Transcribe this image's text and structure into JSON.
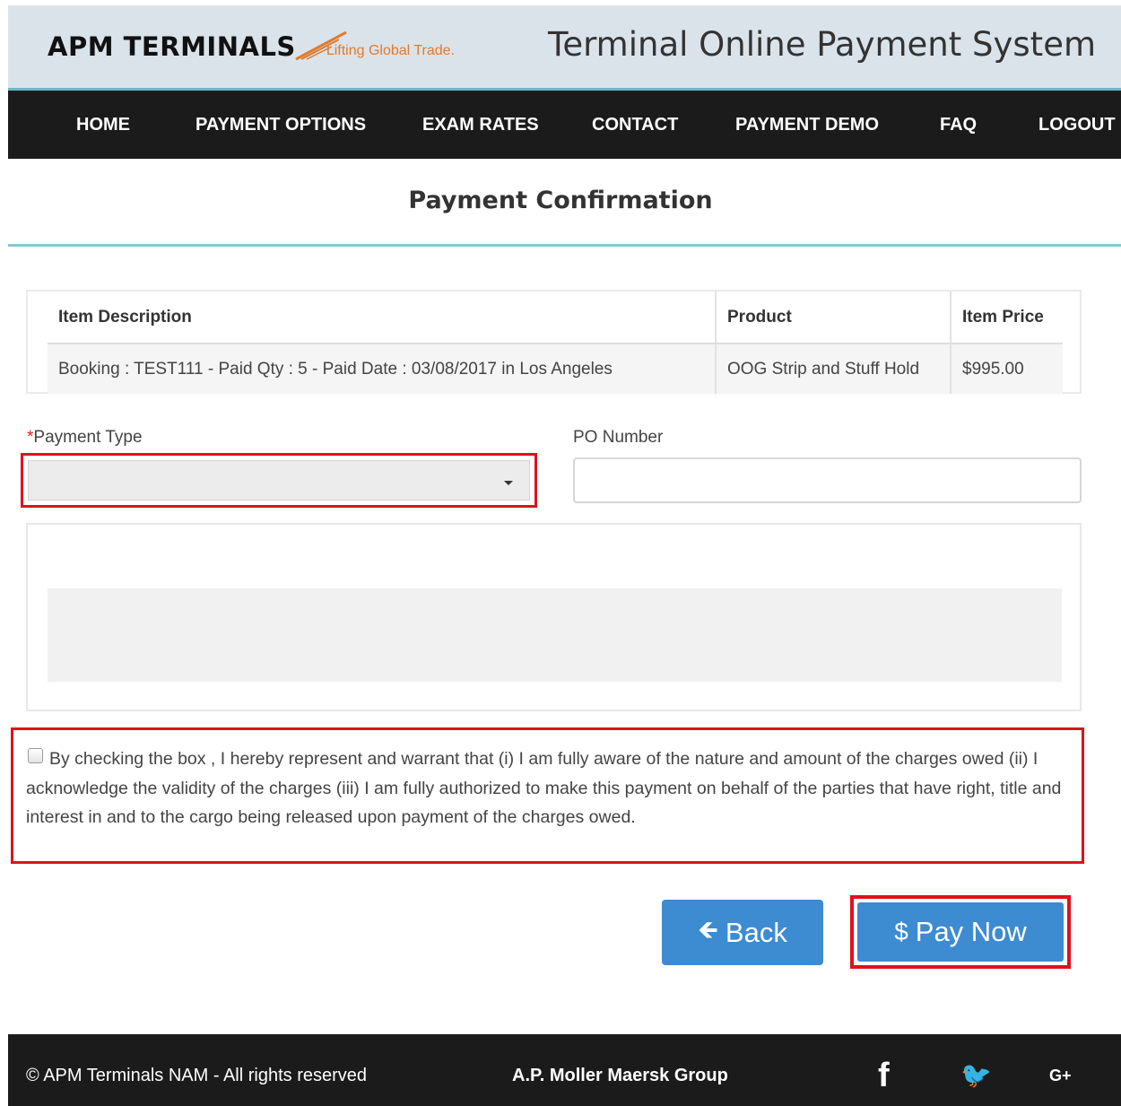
{
  "header": {
    "logo_text": "APM TERMINALS",
    "logo_tagline": "Lifting Global Trade.",
    "site_title": "Terminal Online Payment System",
    "brand_accent": "#e07a2c"
  },
  "nav": {
    "items": [
      {
        "label": "HOME"
      },
      {
        "label": "PAYMENT OPTIONS"
      },
      {
        "label": "EXAM RATES"
      },
      {
        "label": "CONTACT"
      },
      {
        "label": "PAYMENT DEMO"
      },
      {
        "label": "FAQ"
      },
      {
        "label": "LOGOUT"
      }
    ]
  },
  "page": {
    "title": "Payment Confirmation"
  },
  "table": {
    "headers": [
      "Item Description",
      "Product",
      "Item Price"
    ],
    "rows": [
      [
        "Booking : TEST111  -  Paid Qty : 5  -  Paid Date : 03/08/2017  in  Los Angeles",
        "OOG Strip and Stuff Hold",
        "$995.00"
      ]
    ]
  },
  "form": {
    "payment_type_required_mark": "*",
    "payment_type_label": "Payment Type",
    "payment_type_value": "",
    "po_number_label": "PO Number",
    "po_number_value": ""
  },
  "agreement": {
    "checked": false,
    "text": "By checking the box , I hereby represent and warrant that (i) I am fully aware of the nature and amount of the charges owed (ii) I acknowledge the validity of the charges (iii) I am fully authorized to make this payment on behalf of the parties that have right, title and interest in and to the cargo being released upon payment of the charges owed."
  },
  "buttons": {
    "back_icon": "arrow-left-icon",
    "back_icon_glyph": "🡸",
    "back_label": "Back",
    "pay_icon": "dollar-icon",
    "pay_icon_glyph": "$",
    "pay_label": "Pay Now",
    "primary_color": "#3d8bd0",
    "highlight_color": "#e0111d"
  },
  "footer": {
    "copyright": "© APM Terminals NAM - All rights reserved",
    "group": "A.P. Moller Maersk Group",
    "social": [
      {
        "icon": "facebook-icon",
        "glyph": "f"
      },
      {
        "icon": "twitter-icon",
        "glyph": "🐦"
      },
      {
        "icon": "google-plus-icon",
        "glyph": "G+"
      }
    ]
  }
}
